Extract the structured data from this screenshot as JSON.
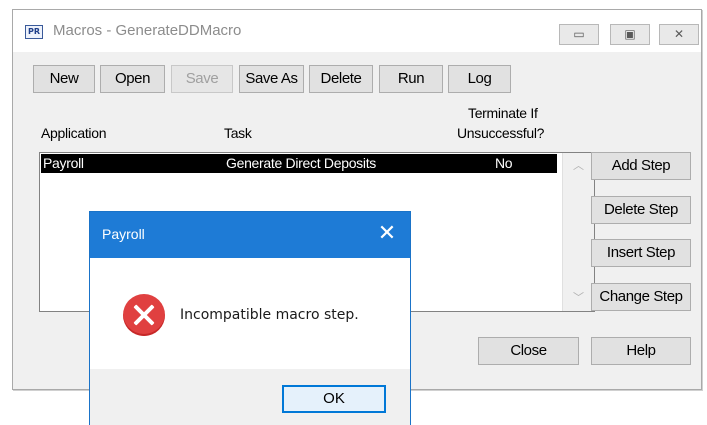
{
  "window": {
    "title": "Macros - GenerateDDMacro",
    "icon_text": "PR",
    "minimize_glyph": "▭",
    "maximize_glyph": "▣",
    "close_glyph": "✕"
  },
  "toolbar": {
    "new": "New",
    "open": "Open",
    "save": "Save",
    "save_as": "Save As",
    "delete": "Delete",
    "run": "Run",
    "log": "Log"
  },
  "columns": {
    "application": "Application",
    "task": "Task",
    "terminate_line1": "Terminate If",
    "terminate_line2": "Unsuccessful?"
  },
  "steps": [
    {
      "application": "Payroll",
      "task": "Generate Direct Deposits",
      "terminate": "No"
    }
  ],
  "side_buttons": {
    "add_step": "Add Step",
    "delete_step": "Delete Step",
    "insert_step": "Insert Step",
    "change_step": "Change Step"
  },
  "footer": {
    "close": "Close",
    "help": "Help"
  },
  "message_box": {
    "title": "Payroll",
    "close_glyph": "✕",
    "icon": "error-icon",
    "text": "Incompatible macro step.",
    "ok": "OK"
  },
  "colors": {
    "selection": "#000000",
    "message_titlebar": "#1e7bd6",
    "error": "#e04040",
    "default_button_border": "#0078d7"
  }
}
